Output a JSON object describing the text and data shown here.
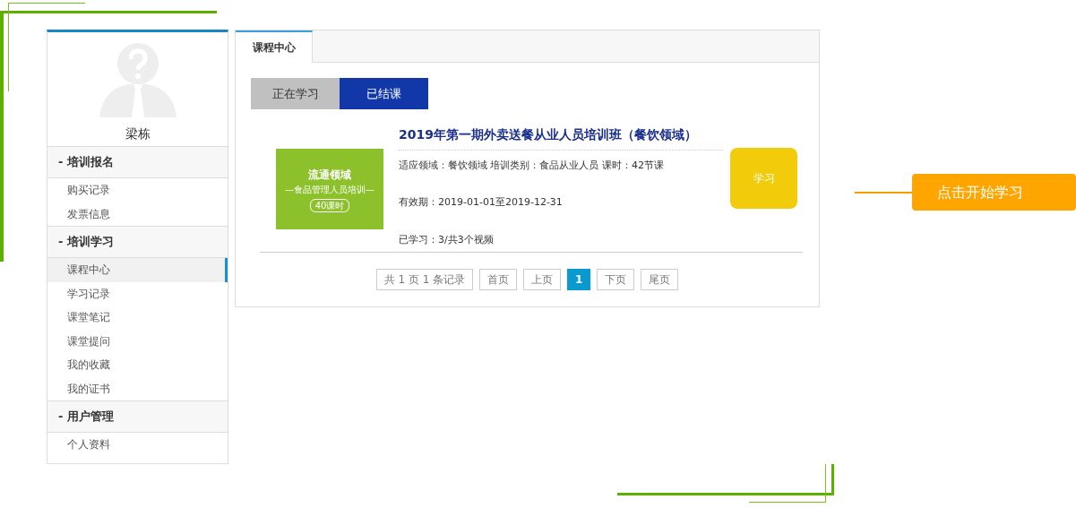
{
  "user": {
    "name": "梁栋"
  },
  "sidebar": {
    "sections": [
      {
        "title": "- 培训报名",
        "items": [
          {
            "label": "购买记录",
            "selected": false
          },
          {
            "label": "发票信息",
            "selected": false
          }
        ]
      },
      {
        "title": "- 培训学习",
        "items": [
          {
            "label": "课程中心",
            "selected": true
          },
          {
            "label": "学习记录",
            "selected": false
          },
          {
            "label": "课堂笔记",
            "selected": false
          },
          {
            "label": "课堂提问",
            "selected": false
          },
          {
            "label": "我的收藏",
            "selected": false
          },
          {
            "label": "我的证书",
            "selected": false
          }
        ]
      },
      {
        "title": "- 用户管理",
        "items": [
          {
            "label": "个人资料",
            "selected": false
          }
        ]
      }
    ]
  },
  "tabs": [
    {
      "label": "课程中心",
      "selected": true
    }
  ],
  "filters": [
    {
      "label": "正在学习",
      "selected": false
    },
    {
      "label": "已结课",
      "selected": true
    }
  ],
  "course": {
    "cover": {
      "title": "流通领域",
      "subtitle": "—食品管理人员培训—",
      "hours": "40课时"
    },
    "title": "2019年第一期外卖送餐从业人员培训班（餐饮领域）",
    "meta": "适应领域：餐饮领域 培训类别：食品从业人员 课时：42节课",
    "validity": "有效期：2019-01-01至2019-12-31",
    "progress": "已学习：3/共3个视频",
    "button": "学习"
  },
  "pagination": {
    "summary": "共 1 页 1 条记录",
    "pages": [
      {
        "label": "首页",
        "selected": false
      },
      {
        "label": "上页",
        "selected": false
      },
      {
        "label": "1",
        "selected": true
      },
      {
        "label": "下页",
        "selected": false
      },
      {
        "label": "尾页",
        "selected": false
      }
    ]
  },
  "callout": {
    "label": "点击开始学习"
  }
}
